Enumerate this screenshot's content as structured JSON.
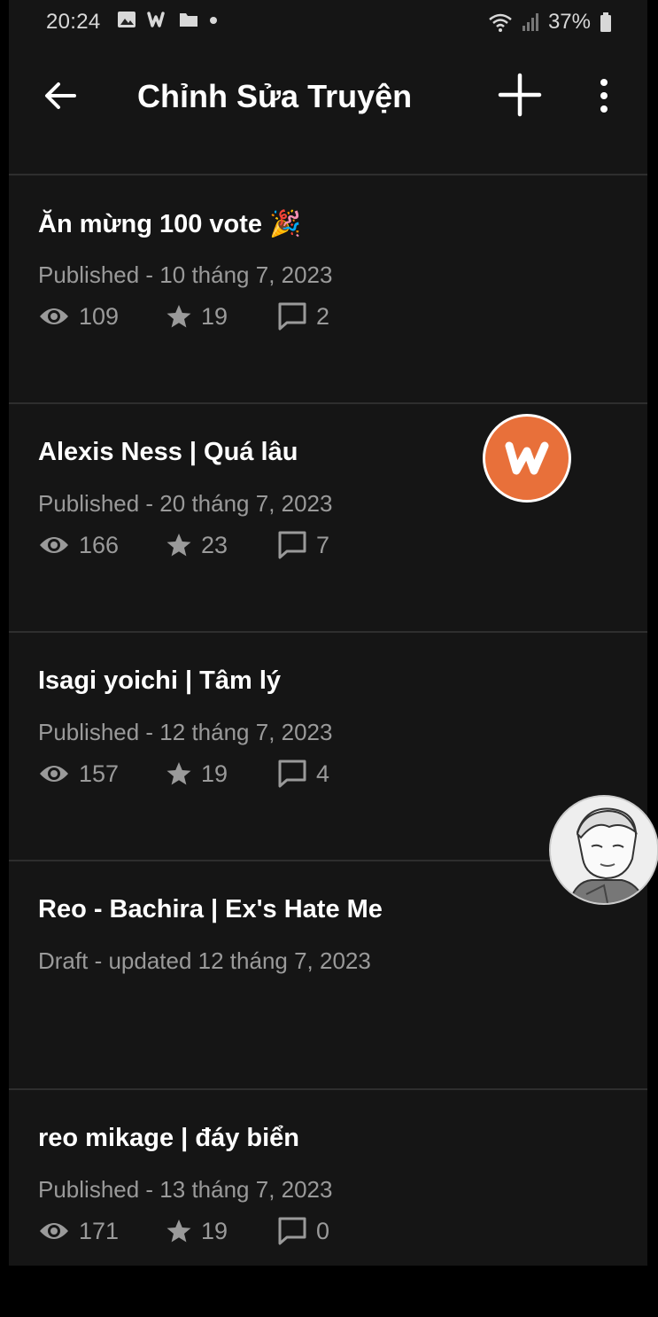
{
  "status_bar": {
    "time": "20:24",
    "battery": "37%",
    "icons": [
      "image-icon",
      "wattpad-icon",
      "folder-icon",
      "dot-icon",
      "wifi-icon",
      "signal-icon",
      "battery-icon"
    ]
  },
  "header": {
    "title": "Chỉnh Sửa Truyện",
    "icons": [
      "back-arrow-icon",
      "plus-icon",
      "more-vert-icon"
    ]
  },
  "stories": [
    {
      "title": "Ăn mừng 100 vote 🎉",
      "meta": "Published - 10 tháng 7, 2023",
      "views": "109",
      "votes": "19",
      "comments": "2"
    },
    {
      "title": "Alexis Ness | Quá lâu",
      "meta": "Published - 20 tháng 7, 2023",
      "views": "166",
      "votes": "23",
      "comments": "7"
    },
    {
      "title": "Isagi yoichi | Tâm lý",
      "meta": "Published - 12 tháng 7, 2023",
      "views": "157",
      "votes": "19",
      "comments": "4"
    },
    {
      "title": "Reo - Bachira | Ex's Hate Me",
      "meta": "Draft - updated 12 tháng 7, 2023"
    },
    {
      "title": "reo mikage | đáy biển",
      "meta": "Published - 13 tháng 7, 2023",
      "views": "171",
      "votes": "19",
      "comments": "0"
    }
  ],
  "colors": {
    "background": "#151515",
    "accent": "#e8703a",
    "meta_text": "#9a9a9a"
  }
}
